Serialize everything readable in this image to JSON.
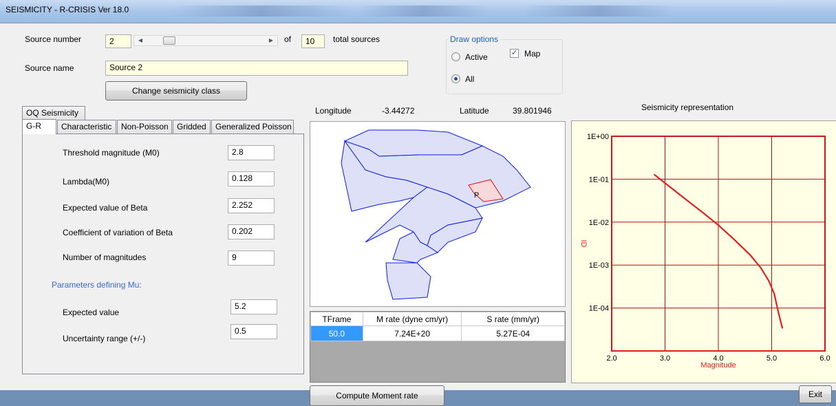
{
  "window": {
    "title": "SEISMICITY - R-CRISIS Ver 18.0"
  },
  "source": {
    "number_label": "Source number",
    "number_value": "2",
    "of_label": "of",
    "total_value": "10",
    "total_label": "total sources",
    "name_label": "Source name",
    "name_value": "Source 2",
    "change_class_button": "Change seismicity class"
  },
  "draw_options": {
    "title": "Draw options",
    "active_label": "Active",
    "all_label": "All",
    "map_label": "Map",
    "selected": "All",
    "map_checked": true
  },
  "tabs": {
    "oq_tab": "OQ Seismicity",
    "items": [
      "G-R",
      "Characteristic",
      "Non-Poisson",
      "Gridded",
      "Generalized Poisson"
    ],
    "active": "G-R"
  },
  "gr": {
    "threshold_label": "Threshold magnitude (M0)",
    "threshold_value": "2.8",
    "lambda_label": "Lambda(M0)",
    "lambda_value": "0.128",
    "beta_label": "Expected value of Beta",
    "beta_value": "2.252",
    "cov_label": "Coefficient of variation of Beta",
    "cov_value": "0.202",
    "nmag_label": "Number of magnitudes",
    "nmag_value": "9",
    "mu_header": "Parameters defining Mu:",
    "mu_expected_label": "Expected value",
    "mu_expected_value": "5.2",
    "mu_uncert_label": "Uncertainty range (+/-)",
    "mu_uncert_value": "0.5"
  },
  "coords": {
    "lon_label": "Longitude",
    "lon_value": "-3.44272",
    "lat_label": "Latitude",
    "lat_value": "39.801946"
  },
  "map": {
    "source_marker": "P"
  },
  "moment_table": {
    "headers": [
      "TFrame",
      "M rate (dyne cm/yr)",
      "S rate (mm/yr)"
    ],
    "rows": [
      [
        "50.0",
        "7.24E+20",
        "5.27E-04"
      ]
    ]
  },
  "compute_button": "Compute Moment rate",
  "exit_button": "Exit",
  "chart_data": {
    "type": "line",
    "title": "Seismicity representation",
    "xlabel": "Magnitude",
    "ylabel": "",
    "y_axis_symbol": "ID",
    "yscale": "log",
    "xlim": [
      2.0,
      6.0
    ],
    "ylim": [
      1e-05,
      1
    ],
    "xticks": [
      "2.0",
      "3.0",
      "4.0",
      "5.0",
      "6.0"
    ],
    "yticks": [
      "1E+00",
      "1E-01",
      "1E-02",
      "1E-03",
      "1E-04"
    ],
    "grid": true,
    "color": "#e02020",
    "series": [
      {
        "x": [
          2.8,
          3.1,
          3.4,
          3.7,
          4.0,
          4.3,
          4.6,
          4.8,
          4.95,
          5.05,
          5.12,
          5.2
        ],
        "y": [
          0.128,
          0.065,
          0.033,
          0.017,
          0.0085,
          0.0039,
          0.0017,
          0.00085,
          0.00042,
          0.00021,
          8.5e-05,
          3.4e-05
        ]
      }
    ]
  }
}
